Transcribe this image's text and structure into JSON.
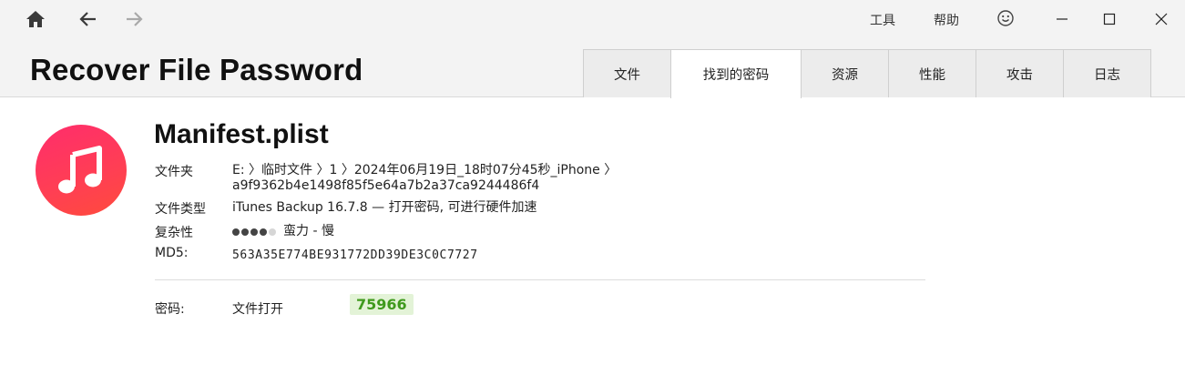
{
  "app": {
    "title": "Recover File Password"
  },
  "toolbar": {
    "home": "home-icon",
    "back": "arrow-left-icon",
    "forward": "arrow-right-icon",
    "tools_label": "工具",
    "help_label": "帮助",
    "feedback": "smiley-icon"
  },
  "window": {
    "minimize": "minimize-icon",
    "maximize": "maximize-icon",
    "close": "close-icon"
  },
  "tabs": [
    {
      "label": "文件",
      "active": false
    },
    {
      "label": "找到的密码",
      "active": true
    },
    {
      "label": "资源",
      "active": false
    },
    {
      "label": "性能",
      "active": false
    },
    {
      "label": "攻击",
      "active": false
    },
    {
      "label": "日志",
      "active": false
    }
  ],
  "file": {
    "icon": "itunes-music-note-icon",
    "name": "Manifest.plist",
    "folder_label": "文件夹",
    "folder_line1": "E: 〉临时文件 〉1 〉2024年06月19日_18时07分45秒_iPhone 〉",
    "folder_line2": "a9f9362b4e1498f85f5e64a7b2a37ca9244486f4",
    "type_label": "文件类型",
    "type_value": "iTunes Backup 16.7.8 — 打开密码, 可进行硬件加速",
    "complexity_label": "复杂性",
    "complexity_level": 4,
    "complexity_max": 5,
    "complexity_value": "蛮力 - 慢",
    "md5_label": "MD5:",
    "md5_value": "563A35E774BE931772DD39DE3C0C7727"
  },
  "password": {
    "label": "密码:",
    "method": "文件打开",
    "value": "75966"
  },
  "colors": {
    "accent_green": "#3f9a1d",
    "password_bg": "#e3f3d7",
    "icon_gradient_start": "#ff2d6c",
    "icon_gradient_end": "#ff4b3c"
  }
}
